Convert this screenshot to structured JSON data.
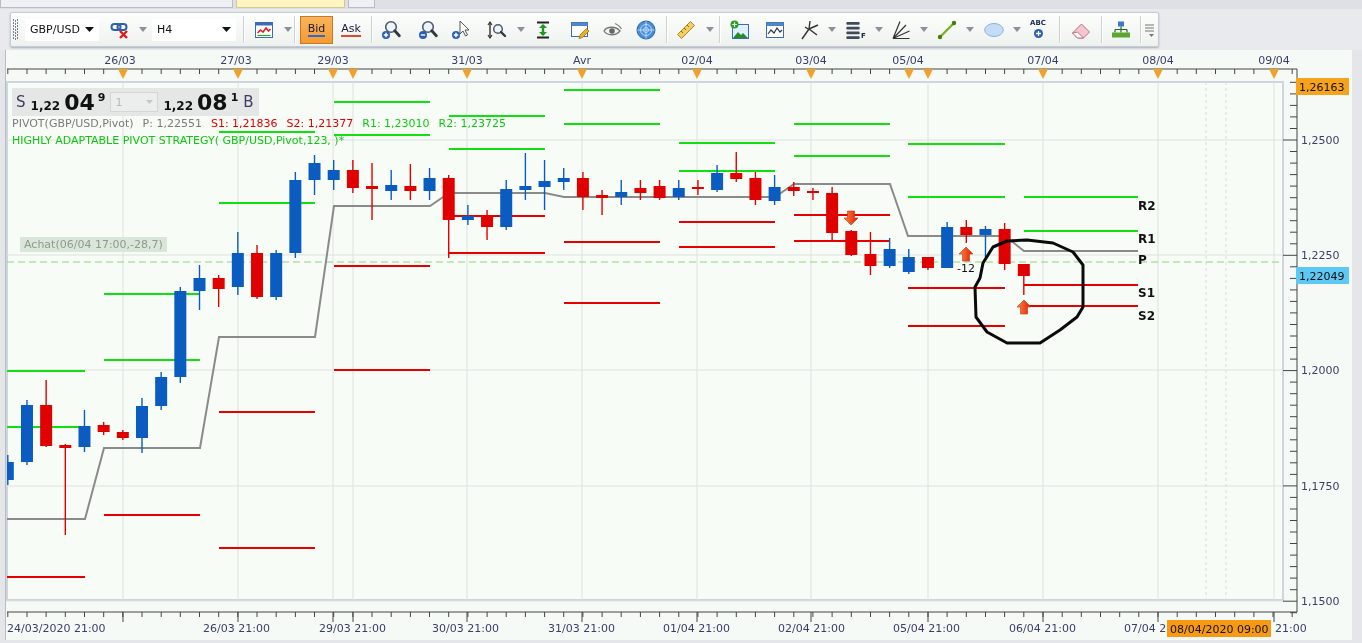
{
  "tabs": [
    {
      "selected": false
    },
    {
      "selected": true
    },
    {
      "selected": false
    }
  ],
  "toolbar": {
    "symbol": {
      "value": "GBP/USD"
    },
    "timeframe": {
      "value": "H4"
    },
    "price_buttons": [
      {
        "label": "Bid",
        "kind": "bid",
        "selected": true
      },
      {
        "label": "Ask",
        "kind": "ask",
        "selected": false
      }
    ],
    "fibonacci_label": "F",
    "text_tool_label": "ABC"
  },
  "chart": {
    "date_axis": [
      "26/03",
      "27/03",
      "29/03",
      "31/03",
      "Avr",
      "02/04",
      "03/04",
      "05/04",
      "07/04",
      "08/04",
      "09/04"
    ],
    "quote_panel": {
      "sell_label": "S",
      "sell_price": {
        "handle": "1,22",
        "pips": "04",
        "fraction": "9"
      },
      "amount_field": {
        "value": "1",
        "disabled": true
      },
      "buy_price": {
        "handle": "1,22",
        "pips": "08",
        "fraction": "1"
      },
      "buy_label": "B"
    },
    "legend": [
      {
        "text": "PIVOT(GBP/USD,Pivot)",
        "kind": "name"
      },
      {
        "text": "P: 1,22551",
        "kind": "pivot"
      },
      {
        "text": "S1: 1,21836",
        "kind": "support"
      },
      {
        "text": "S2: 1,21377",
        "kind": "support"
      },
      {
        "text": "R1: 1,23010",
        "kind": "resistance"
      },
      {
        "text": "R2: 1,23725",
        "kind": "resistance"
      }
    ],
    "strategy_label": "HIGHLY ADAPTABLE PIVOT STRATEGY( GBP/USD,Pivot,123, )*",
    "trade_label": "Achat(06/04 17:00,-28,7)",
    "signal_label": "-12",
    "level_labels": [
      "R2",
      "R1",
      "P",
      "S1",
      "S2"
    ],
    "price_axis": [
      "1,2500",
      "1,2250",
      "1,2000",
      "1,1750",
      "1,1500"
    ],
    "high_price_badge": "1,26163",
    "last_price_badge": "1,22049",
    "time_axis": [
      "24/03/2020 21:00",
      "26/03 21:00",
      "29/03 21:00",
      "30/03 21:00",
      "31/03 21:00",
      "01/04 21:00",
      "02/04 21:00",
      "05/04 21:00",
      "06/04 21:00",
      "07/04 2",
      "21:00"
    ],
    "cursor_time_badge": "08/04/2020 09:00"
  }
}
